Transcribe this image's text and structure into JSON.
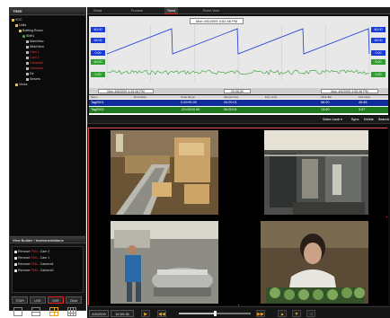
{
  "left_panel": {
    "tree_title": "TREE",
    "tree": [
      {
        "label": "VCC",
        "icon": "folder-icon",
        "color": "default"
      },
      {
        "label": "Units",
        "icon": "folder-icon",
        "color": "default"
      },
      {
        "label": "Bottling Room",
        "icon": "folder-icon",
        "color": "default"
      },
      {
        "label": "Shift1",
        "icon": "status-green-icon",
        "color": "default"
      },
      {
        "label": "MainView",
        "icon": "camera-icon",
        "color": "default"
      },
      {
        "label": "WideView",
        "icon": "camera-icon",
        "color": "default"
      },
      {
        "label": "Cam 1",
        "icon": "camera-icon",
        "color": "red"
      },
      {
        "label": "Cam 2",
        "icon": "camera-icon",
        "color": "red"
      },
      {
        "label": "Camera3",
        "icon": "camera-icon",
        "color": "red"
      },
      {
        "label": "Camera4",
        "icon": "camera-icon",
        "color": "red"
      },
      {
        "label": "Dir",
        "icon": "camera-icon",
        "color": "default"
      },
      {
        "label": "Sewers",
        "icon": "camera-icon",
        "color": "default"
      },
      {
        "label": "Views",
        "icon": "folder-icon",
        "color": "default"
      }
    ],
    "view_builder_title": "View Builder / Instrumentations",
    "view_items": [
      {
        "prefix": "Remove",
        "tag": "PAN",
        "label": "- Cam 2"
      },
      {
        "prefix": "Remove",
        "tag": "PAN",
        "label": "- Cam 1"
      },
      {
        "prefix": "Remove",
        "tag": "PAN",
        "label": "- Camera4"
      },
      {
        "prefix": "Remove",
        "tag": "PAN",
        "label": "- Camera3"
      }
    ],
    "buttons": [
      "TOUR",
      "LIVE",
      "DVR",
      "Clear"
    ],
    "layouts": [
      "single-layout-icon",
      "dual-layout-icon",
      "quad-layout-icon",
      "grid9-layout-icon"
    ],
    "active_layout_index": 2
  },
  "right_panel": {
    "tabs": [
      "Detail",
      "Process",
      "Trend",
      "Event View"
    ],
    "active_tab_index": 2,
    "trend": {
      "timestamp": "Mon 4/6/2009  4:52:46 PM",
      "left_axis": [
        {
          "label": "60.00",
          "color": "#1a3ad8"
        },
        {
          "label": "45.00",
          "color": "#1a3ad8"
        },
        {
          "label": "0.00",
          "color": "#1a3ad8"
        },
        {
          "label": "40.00",
          "color": "#2e9e2e"
        },
        {
          "label": "0.00",
          "color": "#2e9e2e"
        }
      ],
      "right_axis": [
        {
          "label": "60.00",
          "color": "#1a3ad8"
        },
        {
          "label": "45.00",
          "color": "#1a3ad8"
        },
        {
          "label": "0.00",
          "color": "#1a3ad8"
        },
        {
          "label": "6.00",
          "color": "#2e9e2e"
        },
        {
          "label": "0.00",
          "color": "#2e9e2e"
        }
      ],
      "footer_start": "Mon 4/6/2009  4:49:36 PM",
      "footer_span": "00:06:00",
      "footer_end": "Mon 4/6/2009  4:55:36 PM",
      "series_colors": {
        "sawtooth": "#1a3ad8",
        "noise": "#2e9e2e"
      }
    },
    "tag_table": {
      "headers": [
        "Name",
        "Description",
        "Scale Range",
        "Sample Freq",
        "Eng. Units",
        "Value Bar",
        "Last Value"
      ],
      "rows": [
        {
          "cells": [
            "Tag0001",
            "",
            "0.00/90.00",
            "00:00:01",
            "",
            "58.00",
            "46.88"
          ],
          "color": "#102c9a"
        },
        {
          "cells": [
            "Tag0002",
            "",
            "-20.00/10.00",
            "00:00:01",
            "",
            "13.00",
            "3.97"
          ],
          "color": "#1f7a1f"
        }
      ]
    },
    "video_toolbar": {
      "layout_label": "Video Lock ▾",
      "actions": [
        "Sync",
        "Delete",
        "Search"
      ]
    },
    "playback": {
      "date": "4/8/2009",
      "time": "16:55:36",
      "position": 0.5
    }
  }
}
